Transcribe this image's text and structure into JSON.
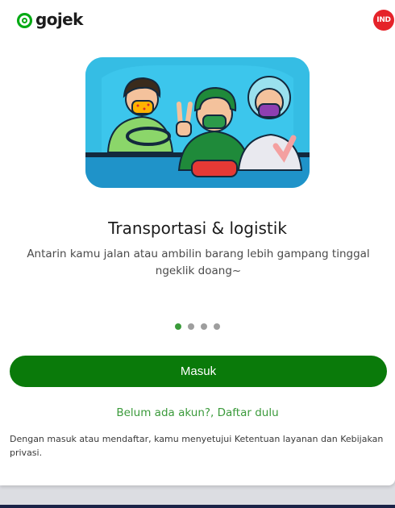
{
  "header": {
    "logo_text": "gojek",
    "language_badge": "IND"
  },
  "colors": {
    "brand_green": "#0a7a0a",
    "link_green": "#3b9a3b",
    "badge_red": "#e5232a"
  },
  "onboarding": {
    "illustration_icon": "riders-illustration",
    "title": "Transportasi & logistik",
    "description": "Antarin kamu jalan atau ambilin barang lebih gampang tinggal ngeklik doang~",
    "page_count": 4,
    "active_page": 1
  },
  "actions": {
    "login_label": "Masuk",
    "signup_label": "Belum ada akun?, Daftar dulu"
  },
  "terms_text": "Dengan masuk atau mendaftar, kamu menyetujui Ketentuan layanan dan Kebijakan privasi."
}
